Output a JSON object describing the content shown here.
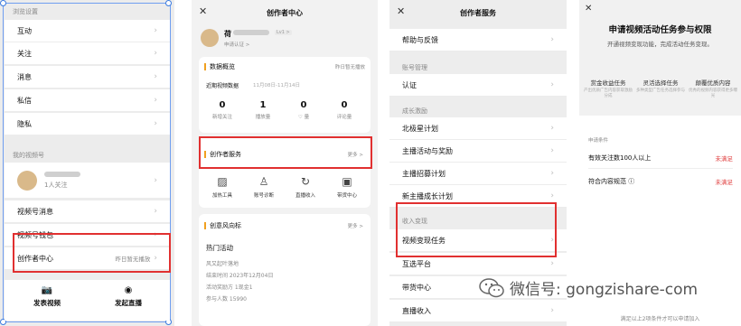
{
  "s1": {
    "section_title": "浏览设置",
    "items": [
      "互动",
      "关注",
      "消息",
      "私信",
      "隐私"
    ],
    "my_channel_label": "我的视频号",
    "follower_count": "1人关注",
    "channel_msg": "视频号消息",
    "channel_wallet": "视频号钱包",
    "creator_center": "创作者中心",
    "creator_center_status": "昨日暂无播放",
    "post_video": "发表视频",
    "start_live": "发起直播"
  },
  "s2": {
    "title": "创作者中心",
    "user_name": "荷",
    "user_badge": "Lv1 >",
    "user_cert": "申请认证 >",
    "overview_title": "数据概览",
    "overview_right": "昨日暂无播放",
    "recent_label": "近期视频数据",
    "date_range": "11月08日-11月14日",
    "stats": [
      {
        "value": "0",
        "label": "新增关注"
      },
      {
        "value": "1",
        "label": "播放量"
      },
      {
        "value": "0",
        "label": "♡ 量"
      },
      {
        "value": "0",
        "label": "评论量"
      }
    ],
    "service_title": "创作者服务",
    "service_more": "更多 >",
    "tools": [
      "加热工具",
      "账号诊断",
      "直播收入",
      "带货中心"
    ],
    "inspire_title": "创意风向标",
    "inspire_more": "更多 >",
    "hot_title": "热门活动",
    "hot_lines": [
      "风又起叶落地",
      "结束时间  2023年12月04日",
      "活动奖励方  1现金1",
      "参与人数  15990"
    ]
  },
  "s3": {
    "title": "创作者服务",
    "help": "帮助与反馈",
    "account_label": "账号管理",
    "cert": "认证",
    "growth_label": "成长激励",
    "growth_items": [
      "北极星计划",
      "主播活动与奖励",
      "主播招募计划",
      "新主播成长计划"
    ],
    "income_label": "收入变现",
    "income_items": [
      "视频变现任务",
      "互选平台",
      "带货中心",
      "直播收入"
    ]
  },
  "s4": {
    "title": "申请视频活动任务参与权限",
    "subtitle": "开通视频变现功能，完成活动任务变现。",
    "features": [
      {
        "title": "赏金收益任务",
        "desc": "产出优质广告内容获取激励分成"
      },
      {
        "title": "灵活选择任务",
        "desc": "多种类型广告任务选择参与"
      },
      {
        "title": "颠覆优质内容",
        "desc": "优秀的视频内容获得更多曝光"
      }
    ],
    "cond_label": "申请条件",
    "conditions": [
      {
        "text": "有效关注数100人以上",
        "status": "未满足"
      },
      {
        "text": "符合内容规范 ⓘ",
        "status": "未满足"
      }
    ],
    "footer": "满足以上2项条件才可以申请加入"
  },
  "watermark": "微信号: gongzishare-com",
  "colors": {
    "highlight": "#e13030",
    "accent": "#f0a020",
    "unmet": "#e04040"
  }
}
